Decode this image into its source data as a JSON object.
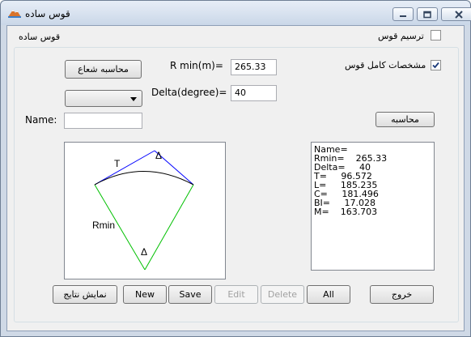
{
  "window": {
    "title": "قوس ساده",
    "header_label": "قوس ساده",
    "icon": "mountain-icon",
    "controls": [
      "minimize-icon",
      "maximize-icon",
      "close-icon"
    ]
  },
  "options": {
    "draw_arc_label": "ترسیم قوس",
    "draw_arc_checked": false,
    "full_arc_specs_label": "مشخصات کامل قوس",
    "full_arc_specs_checked": true
  },
  "inputs": {
    "calc_radius_button": "محاسبه شعاع",
    "rmin_label": "R min(m)=",
    "rmin_value": "265.33",
    "delta_label": "Delta(degree)=",
    "delta_value": "40",
    "name_label": "Name:",
    "name_value": "",
    "dropdown_value": "",
    "calculate_button": "محاسبه"
  },
  "diagram": {
    "t_label": "T",
    "delta_top_label": "Δ",
    "rmin_label": "Rmin",
    "delta_bottom_label": "Δ",
    "colors": {
      "tangent": "#0000ff",
      "radius": "#00c000",
      "arc": "#000000"
    }
  },
  "results": [
    "Name=",
    "Rmin=    265.33",
    "Delta=     40",
    "T=     96.572",
    "L=     185.235",
    "C=     181.496",
    "BI=     17.028",
    "M=    163.703"
  ],
  "buttons": {
    "show_results": "نمایش نتایج",
    "new": "New",
    "save": "Save",
    "edit": "Edit",
    "delete": "Delete",
    "all": "All",
    "exit": "خروج"
  }
}
